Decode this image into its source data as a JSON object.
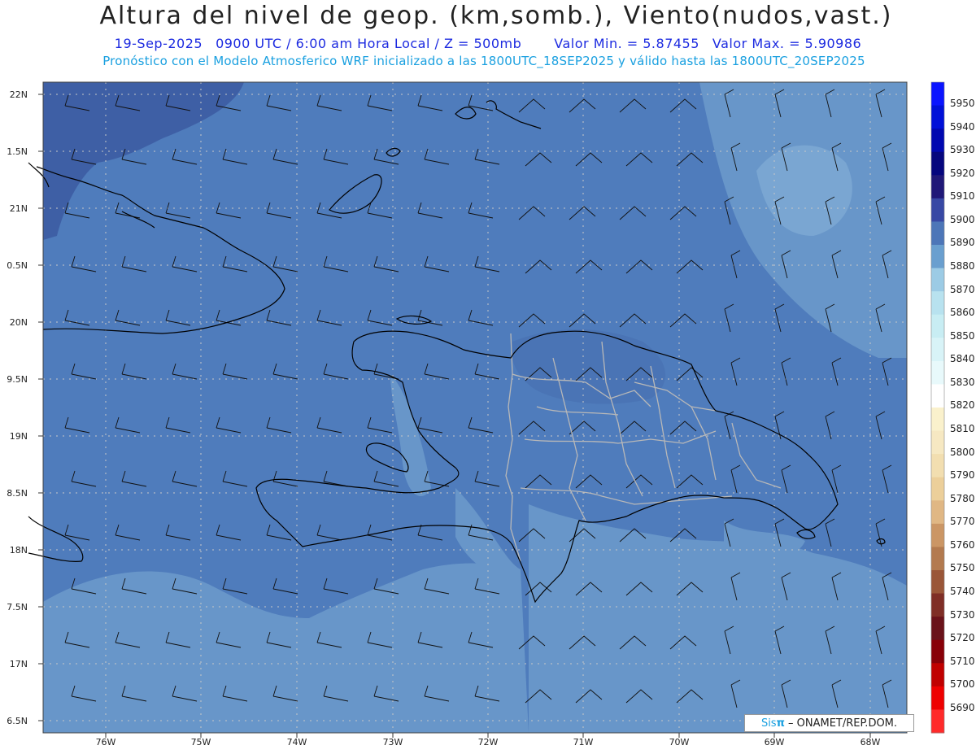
{
  "header": {
    "title": "Altura del nivel de geop. (km,somb.), Viento(nudos,vast.)",
    "date": "19-Sep-2025",
    "time": "0900 UTC / 6:00 am Hora Local / Z = 500mb",
    "vmin": "Valor Min. = 5.87455",
    "vmax": "Valor Max. = 5.90986",
    "model_info": "Pronóstico con el Modelo Atmosferico WRF inicializado a las 1800UTC_18SEP2025 y válido hasta las  1800UTC_20SEP2025"
  },
  "axes": {
    "lat_labels": [
      "22N",
      "1.5N",
      "21N",
      "0.5N",
      "20N",
      "9.5N",
      "19N",
      "8.5N",
      "18N",
      "7.5N",
      "17N",
      "6.5N"
    ],
    "lon_labels": [
      "76W",
      "75W",
      "74W",
      "73W",
      "72W",
      "71W",
      "70W",
      "69W",
      "68W"
    ]
  },
  "colorbar": {
    "labels": [
      "5950",
      "5940",
      "5930",
      "5920",
      "5910",
      "5900",
      "5890",
      "5880",
      "5870",
      "5860",
      "5850",
      "5840",
      "5830",
      "5820",
      "5810",
      "5800",
      "5790",
      "5780",
      "5770",
      "5760",
      "5750",
      "5740",
      "5730",
      "5720",
      "5710",
      "5700",
      "5690"
    ],
    "colors": [
      "#0a14ff",
      "#0010d8",
      "#0008b0",
      "#05067e",
      "#201878",
      "#3848a4",
      "#4d76b8",
      "#6a9fcf",
      "#9ccbe5",
      "#b8e2ef",
      "#c8edf3",
      "#d8f3f7",
      "#e8f9fb",
      "#ffffff",
      "#faf1cc",
      "#f6e8c2",
      "#f2deb0",
      "#eccf9a",
      "#e0b784",
      "#cb9665",
      "#b37a4f",
      "#9a5638",
      "#7f2e26",
      "#6a121a",
      "#880008",
      "#c00000",
      "#ee0000",
      "#ff2a2a"
    ]
  },
  "credit": {
    "brand_a": "Sis",
    "brand_b": "π",
    "text": "– ONAMET/REP.DOM."
  },
  "style": {
    "field_dark": "#3e5fa5",
    "field_mid": "#4f7cbc",
    "field_light": "#6896c9",
    "coast": "#000000",
    "province": "#b8b8b8"
  }
}
